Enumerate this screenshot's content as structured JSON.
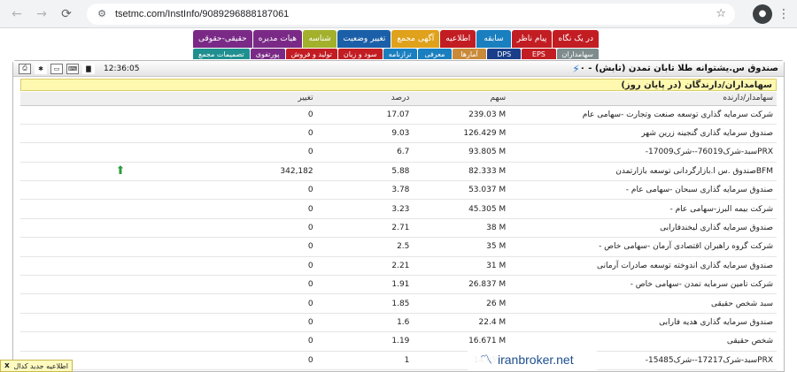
{
  "browser": {
    "url": "tsetmc.com/InstInfo/9089296888187061"
  },
  "tabs_top": [
    {
      "label": "در یک نگاه",
      "color": "#c21d23"
    },
    {
      "label": "پیام ناظر",
      "color": "#c21d23"
    },
    {
      "label": "سابقه",
      "color": "#1a7fbf"
    },
    {
      "label": "اطلاعیه",
      "color": "#c21d23"
    },
    {
      "label": "آگهی مجمع",
      "color": "#e0a11b"
    },
    {
      "label": "تغییر وضعیت",
      "color": "#1a5fa8"
    },
    {
      "label": "شناسه",
      "color": "#a2b02b"
    },
    {
      "label": "هیات مدیره",
      "color": "#7a2a86"
    },
    {
      "label": "حقیقی-حقوقی",
      "color": "#7a2a86"
    }
  ],
  "tabs_bottom": [
    {
      "label": "سهامداران",
      "color": "#7f8c8d"
    },
    {
      "label": "EPS",
      "color": "#c21d23"
    },
    {
      "label": "DPS",
      "color": "#1a3e8a"
    },
    {
      "label": "آمارها",
      "color": "#c98a3a"
    },
    {
      "label": "معرفی",
      "color": "#1a7fbf"
    },
    {
      "label": "ترازنامه",
      "color": "#1a7fbf"
    },
    {
      "label": "سود و زیان",
      "color": "#c21d23"
    },
    {
      "label": "تولید و فروش",
      "color": "#c21d23"
    },
    {
      "label": "پورتفوی",
      "color": "#7a2a86"
    },
    {
      "label": "تصمیمات مجمع",
      "color": "#1f8f8f"
    }
  ],
  "panel": {
    "title": "صندوق س.یشتوانه طلا تابان تمدن (تابش) - ۰",
    "time": "12:36:05",
    "section_title": "سهامداران/دارندگان (در پایان روز)"
  },
  "table": {
    "headers": {
      "holder": "سهامدار/دارنده",
      "shares": "سهم",
      "percent": "درصد",
      "change": "تغییر"
    },
    "rows": [
      {
        "holder": "شرکت سرمایه گذاری توسعه صنعت وتجارت -سهامی عام",
        "shares": "239.03 M",
        "percent": "17.07",
        "change": "0",
        "up": false
      },
      {
        "holder": "صندوق سرمایه گذاری گنجینه زرین شهر",
        "shares": "126.429 M",
        "percent": "9.03",
        "change": "0",
        "up": false
      },
      {
        "holder": "PRXسبد-شرک76019--شرک17009-",
        "shares": "93.805 M",
        "percent": "6.7",
        "change": "0",
        "up": false
      },
      {
        "holder": "BFMصندوق .س ا.بازارگردانی توسعه بازارتمدن",
        "shares": "82.333 M",
        "percent": "5.88",
        "change": "342,182",
        "up": true
      },
      {
        "holder": "صندوق سرمایه گذاری سبحان -سهامی عام -",
        "shares": "53.037 M",
        "percent": "3.78",
        "change": "0",
        "up": false
      },
      {
        "holder": "شرکت بیمه البرز-سهامی عام -",
        "shares": "45.305 M",
        "percent": "3.23",
        "change": "0",
        "up": false
      },
      {
        "holder": "صندوق سرمایه گذاری لیخندفارابی",
        "shares": "38 M",
        "percent": "2.71",
        "change": "0",
        "up": false
      },
      {
        "holder": "شرکت گروه راهبران اقتصادی آرمان -سهامی خاص -",
        "shares": "35 M",
        "percent": "2.5",
        "change": "0",
        "up": false
      },
      {
        "holder": "صندوق سرمایه گذاری اندوخته توسعه صادرات آرمانی",
        "shares": "31 M",
        "percent": "2.21",
        "change": "0",
        "up": false
      },
      {
        "holder": "شرکت تامین سرمایه تمدن -سهامی خاص -",
        "shares": "26.837 M",
        "percent": "1.91",
        "change": "0",
        "up": false
      },
      {
        "holder": "سبد شخص حقیقی",
        "shares": "26 M",
        "percent": "1.85",
        "change": "0",
        "up": false
      },
      {
        "holder": "صندوق سرمایه گذاری هدیه فارابی",
        "shares": "22.4 M",
        "percent": "1.6",
        "change": "0",
        "up": false
      },
      {
        "holder": "شخص حقیقی",
        "shares": "16.671 M",
        "percent": "1.19",
        "change": "0",
        "up": false
      },
      {
        "holder": "PRXسبد-شرک17217--شرک15485-",
        "shares": "14.05 M",
        "percent": "1",
        "change": "0",
        "up": false
      }
    ]
  },
  "notification": {
    "text": "اطلاعیه جدید کدال",
    "close": "x"
  },
  "watermark": {
    "text": "iranbroker.net"
  }
}
